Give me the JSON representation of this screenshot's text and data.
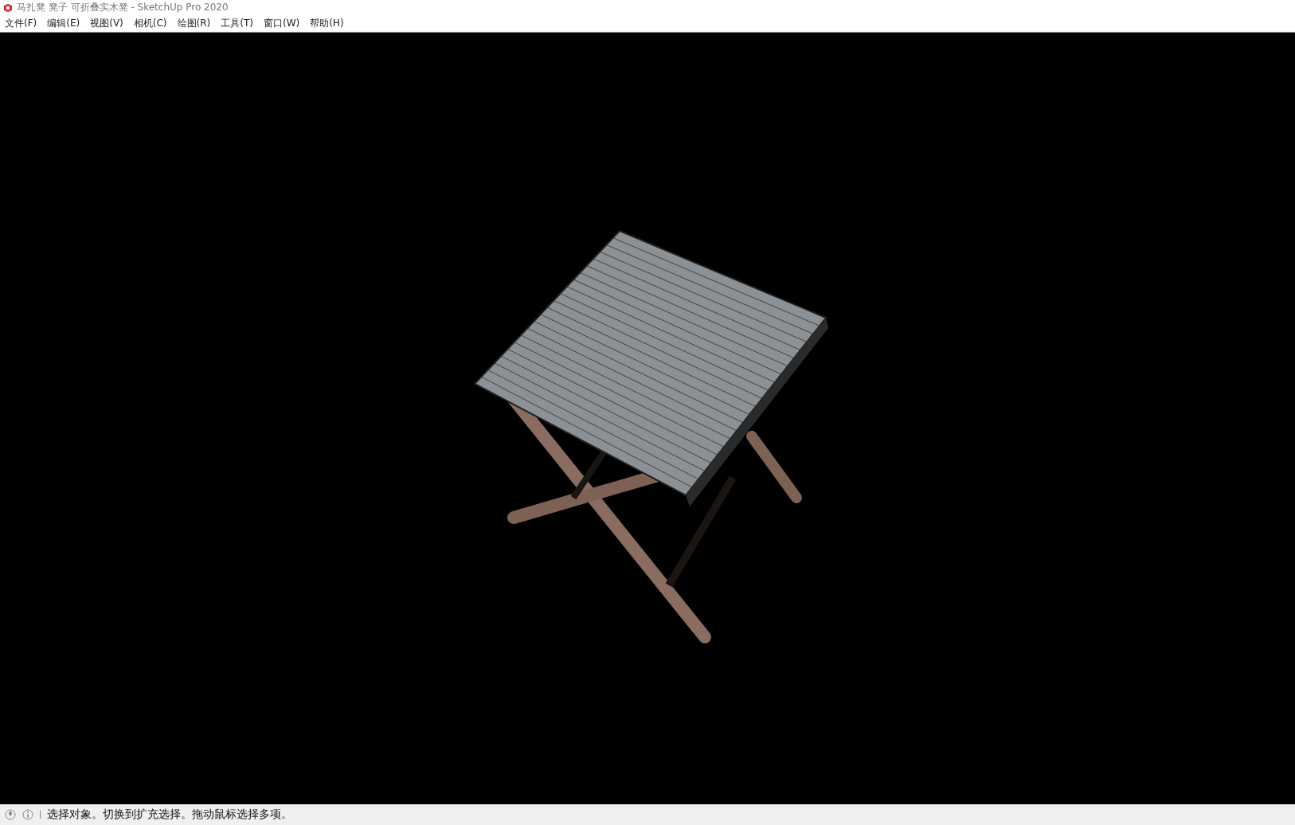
{
  "window": {
    "title": "马扎凳 凳子 可折叠实木凳 - SketchUp Pro 2020"
  },
  "menu": [
    {
      "label": "文件(F)"
    },
    {
      "label": "编辑(E)"
    },
    {
      "label": "视图(V)"
    },
    {
      "label": "相机(C)"
    },
    {
      "label": "绘图(R)"
    },
    {
      "label": "工具(T)"
    },
    {
      "label": "窗口(W)"
    },
    {
      "label": "帮助(H)"
    }
  ],
  "status_bar": {
    "message": "选择对象。切换到扩充选择。拖动鼠标选择多项。"
  }
}
